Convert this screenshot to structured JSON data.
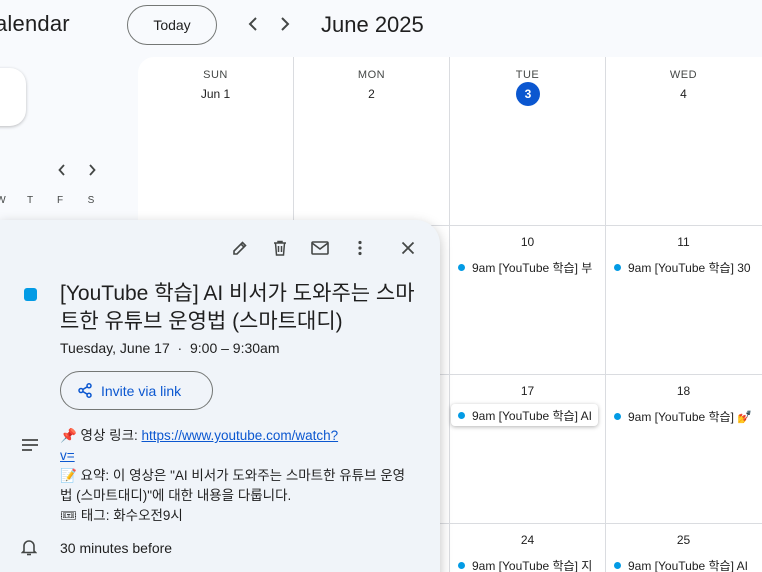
{
  "header": {
    "app_title": "alendar",
    "today_label": "Today",
    "month_title": "June 2025"
  },
  "mini_calendar": {
    "weekday_initials": [
      "W",
      "T",
      "F",
      "S"
    ]
  },
  "grid": {
    "days_of_week": [
      "SUN",
      "MON",
      "TUE",
      "WED"
    ],
    "week1_dates": [
      "Jun 1",
      "2",
      "3",
      "4"
    ],
    "week2_dates": [
      "10",
      "11"
    ],
    "week3_dates": [
      "17",
      "18"
    ],
    "week4_dates": [
      "24",
      "25"
    ],
    "events": {
      "w2_tue": "9am [YouTube 학습] 부",
      "w2_wed": "9am [YouTube 학습] 30",
      "w3_tue": "9am [YouTube 학습] AI",
      "w3_wed": "9am [YouTube 학습] 💅",
      "w4_tue": "9am [YouTube 학습] 지",
      "w4_wed": "9am [YouTube 학습] AI"
    },
    "event_color": "#039be5",
    "today_color": "#0b57d0"
  },
  "popover": {
    "title": "[YouTube 학습] AI 비서가 도와주는 스마트한 유튜브 운영법 (스마트대디)",
    "date": "Tuesday, June 17",
    "separator": "·",
    "time": "9:00 – 9:30am",
    "invite_label": "Invite via link",
    "desc_line1_prefix": "📌 영상 링크: ",
    "desc_link": "https://www.youtube.com/watch?",
    "desc_link_cont": "v=",
    "desc_line2": "📝 요약: 이 영상은 \"AI 비서가 도와주는 스마트한 유튜브 운영",
    "desc_line3": "법 (스마트대디)\"에 대한 내용을 다룹니다.",
    "desc_line4": "🎟 태그: 화수오전9시",
    "reminder": "30 minutes before",
    "icons": [
      "edit-icon",
      "delete-icon",
      "email-icon",
      "more-options-icon",
      "close-icon"
    ]
  }
}
